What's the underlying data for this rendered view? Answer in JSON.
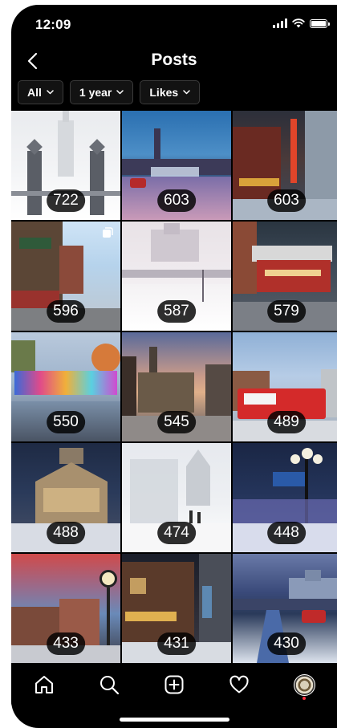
{
  "status_bar": {
    "time": "12:09",
    "icons": [
      "cellular-signal-icon",
      "wifi-icon",
      "battery-icon"
    ]
  },
  "header": {
    "title": "Posts",
    "back_icon": "chevron-left-icon"
  },
  "filters": [
    {
      "label": "All"
    },
    {
      "label": "1 year"
    },
    {
      "label": "Likes"
    }
  ],
  "posts": [
    {
      "likes": "722"
    },
    {
      "likes": "603"
    },
    {
      "likes": "603"
    },
    {
      "likes": "596",
      "multi": true
    },
    {
      "likes": "587"
    },
    {
      "likes": "579"
    },
    {
      "likes": "550"
    },
    {
      "likes": "545"
    },
    {
      "likes": "489"
    },
    {
      "likes": "488"
    },
    {
      "likes": "474"
    },
    {
      "likes": "448"
    },
    {
      "likes": "433"
    },
    {
      "likes": "431"
    },
    {
      "likes": "430"
    }
  ],
  "bottom_nav": {
    "items": [
      "home-icon",
      "search-icon",
      "new-post-icon",
      "activity-heart-icon",
      "profile-avatar"
    ],
    "notification_color": "#ff3040"
  },
  "colors": {
    "background": "#000000",
    "text": "#ffffff",
    "chip_border": "#3a3a3a"
  }
}
